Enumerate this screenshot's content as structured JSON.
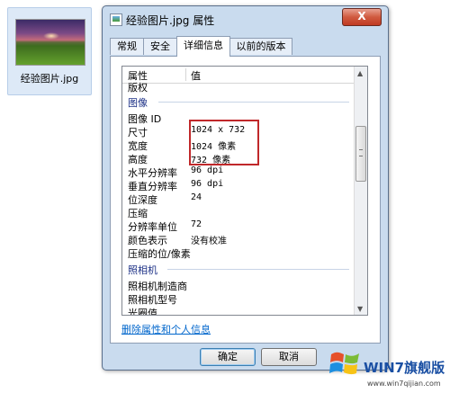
{
  "desktop": {
    "file_name": "经验图片.jpg"
  },
  "dialog": {
    "title": "经验图片.jpg 属性",
    "close_label": "X",
    "tabs": [
      {
        "label": "常规",
        "active": false
      },
      {
        "label": "安全",
        "active": false
      },
      {
        "label": "详细信息",
        "active": true
      },
      {
        "label": "以前的版本",
        "active": false
      }
    ],
    "columns": {
      "property": "属性",
      "value": "值"
    },
    "rows": [
      {
        "type": "item",
        "property": "版权",
        "value": ""
      },
      {
        "type": "group",
        "property": "图像"
      },
      {
        "type": "item",
        "property": "图像 ID",
        "value": ""
      },
      {
        "type": "item",
        "property": "尺寸",
        "value": "1024 x 732"
      },
      {
        "type": "item",
        "property": "宽度",
        "value": "1024 像素"
      },
      {
        "type": "item",
        "property": "高度",
        "value": "732 像素"
      },
      {
        "type": "item",
        "property": "水平分辨率",
        "value": "96 dpi"
      },
      {
        "type": "item",
        "property": "垂直分辨率",
        "value": "96 dpi"
      },
      {
        "type": "item",
        "property": "位深度",
        "value": "24"
      },
      {
        "type": "item",
        "property": "压缩",
        "value": ""
      },
      {
        "type": "item",
        "property": "分辨率单位",
        "value": "72"
      },
      {
        "type": "item",
        "property": "颜色表示",
        "value": "没有校准"
      },
      {
        "type": "item",
        "property": "压缩的位/像素",
        "value": ""
      },
      {
        "type": "group",
        "property": "照相机"
      },
      {
        "type": "item",
        "property": "照相机制造商",
        "value": ""
      },
      {
        "type": "item",
        "property": "照相机型号",
        "value": ""
      },
      {
        "type": "item",
        "property": "光圈值",
        "value": ""
      }
    ],
    "remove_link": "删除属性和个人信息",
    "buttons": {
      "ok": "确定",
      "cancel": "取消"
    }
  },
  "watermark": {
    "brand": "WIN7旗舰版",
    "url": "www.win7qijian.com"
  },
  "colors": {
    "highlight_border": "#c0282a",
    "link": "#0066cc",
    "group_text": "#1e3287"
  }
}
